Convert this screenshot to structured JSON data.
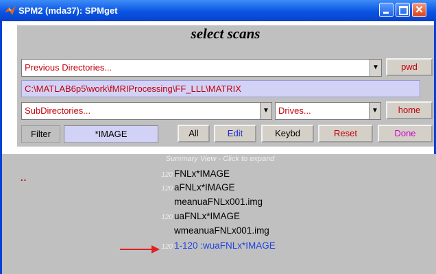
{
  "window": {
    "title": "SPM2 (mda37): SPMget"
  },
  "panel": {
    "title": "select scans",
    "previous_dirs": "Previous Directories...",
    "pwd_label": "pwd",
    "current_path": "C:\\MATLAB6p5\\work\\fMRIProcessing\\FF_LLL\\MATRIX",
    "subdirs": "SubDirectories...",
    "drives": "Drives...",
    "home_label": "home",
    "filter_label": "Filter",
    "filter_value": "*IMAGE",
    "buttons": {
      "all": "All",
      "edit": "Edit",
      "keybd": "Keybd",
      "reset": "Reset",
      "done": "Done"
    }
  },
  "list": {
    "summary_header": "Summary View - Click to expand",
    "parent_dir": "..",
    "items": [
      {
        "count": "120",
        "name": "FNLx*IMAGE"
      },
      {
        "count": "120",
        "name": "aFNLx*IMAGE"
      },
      {
        "count": "",
        "name": "meanuaFNLx001.img"
      },
      {
        "count": "120",
        "name": "uaFNLx*IMAGE"
      },
      {
        "count": "",
        "name": "wmeanuaFNLx001.img"
      },
      {
        "count": "120",
        "name": "1-120 :wuaFNLx*IMAGE"
      }
    ]
  },
  "colors": {
    "titlebar": "#0a54e4",
    "accent_red": "#c3000a",
    "selected_item": "#2244dd",
    "done_magenta": "#cc00cc",
    "edit_blue": "#1a2acc",
    "arrow": "#e02020"
  }
}
